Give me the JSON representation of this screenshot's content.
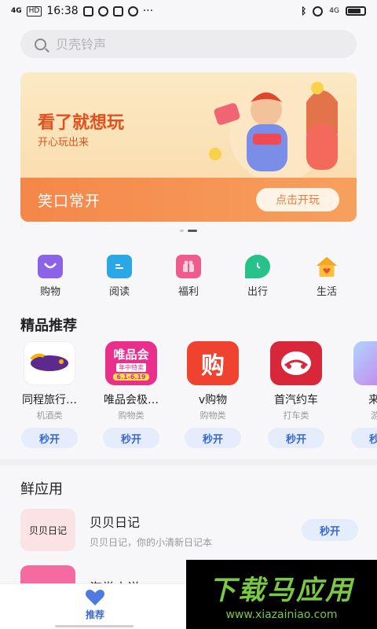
{
  "status_bar": {
    "signal": "4G",
    "hd": "HD",
    "time": "16:38",
    "dots": "···",
    "right_signal": "4G"
  },
  "search": {
    "placeholder": "贝壳铃声"
  },
  "banner": {
    "title": "看了就想玩",
    "subtitle": "开心玩出来",
    "slogan": "笑口常开",
    "button": "点击开玩"
  },
  "categories": [
    {
      "label": "购物",
      "icon": "shopping-bag-icon",
      "color": "#8c63e6"
    },
    {
      "label": "阅读",
      "icon": "book-icon",
      "color": "#2aa8e6"
    },
    {
      "label": "福利",
      "icon": "gift-icon",
      "color": "#f05a8d"
    },
    {
      "label": "出行",
      "icon": "location-icon",
      "color": "#27c28a"
    },
    {
      "label": "生活",
      "icon": "house-icon",
      "color": "#f7a623"
    }
  ],
  "featured": {
    "title": "精品推荐",
    "open_label": "秒开",
    "apps": [
      {
        "name": "同程旅行…",
        "category": "机酒类",
        "icon": "tongcheng-icon",
        "color": "#ffffff"
      },
      {
        "name": "唯品会极…",
        "category": "购物类",
        "icon": "vipshop-icon",
        "color": "#ea2e8c",
        "badge": "唯品会",
        "badge_sub": "年中特卖",
        "badge_date": "6.1-6.19"
      },
      {
        "name": "v购物",
        "category": "购物类",
        "icon": "vgou-icon",
        "color": "#f0432f",
        "glyph": "购"
      },
      {
        "name": "首汽约车",
        "category": "打车类",
        "icon": "car-icon",
        "color": "#d8263b"
      },
      {
        "name": "来切",
        "category": "游戏",
        "icon": "game-icon",
        "color": "#c872e8"
      }
    ]
  },
  "fresh": {
    "title": "鲜应用",
    "items": [
      {
        "name": "贝贝日记",
        "desc": "贝贝日记，你的小清新日记本",
        "button": "秒开",
        "icon_text": "贝贝日记",
        "color": "#fbe2e5"
      },
      {
        "name": "海棠小说",
        "desc": "",
        "button": "",
        "icon_text": "",
        "color": "#f56aa0"
      }
    ]
  },
  "bottom_nav": {
    "label": "推荐"
  },
  "watermark": {
    "line1": "下载马应用",
    "line2": "www.xiazainiao.com"
  }
}
